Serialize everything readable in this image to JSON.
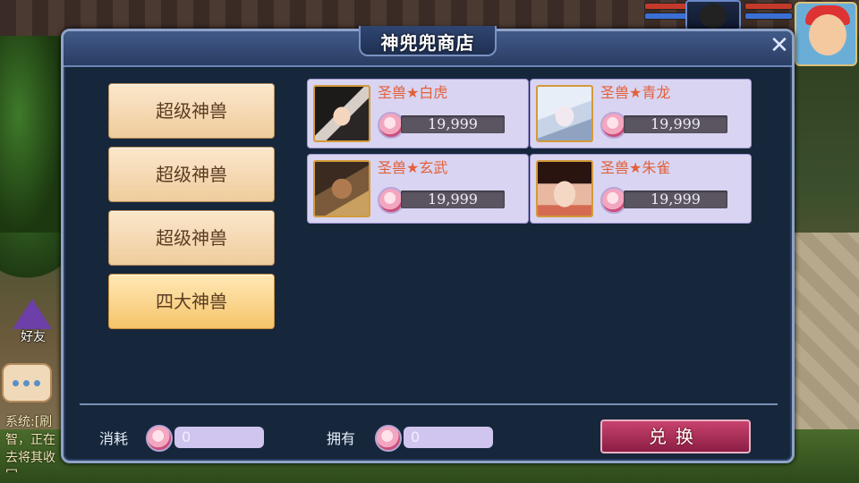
{
  "shop": {
    "title": "神兜兜商店",
    "close_symbol": "✕"
  },
  "categories": [
    {
      "label": "超级神兽",
      "active": false
    },
    {
      "label": "超级神兽",
      "active": false
    },
    {
      "label": "超级神兽",
      "active": false
    },
    {
      "label": "四大神兽",
      "active": true
    }
  ],
  "items": [
    {
      "name": "圣兽★白虎",
      "price": "19,999",
      "portrait_icon": "white-tiger-portrait"
    },
    {
      "name": "圣兽★青龙",
      "price": "19,999",
      "portrait_icon": "azure-dragon-portrait"
    },
    {
      "name": "圣兽★玄武",
      "price": "19,999",
      "portrait_icon": "black-tortoise-portrait"
    },
    {
      "name": "圣兽★朱雀",
      "price": "19,999",
      "portrait_icon": "vermilion-bird-portrait"
    }
  ],
  "footer": {
    "cost_label": "消耗",
    "cost_value": "0",
    "own_label": "拥有",
    "own_value": "0",
    "exchange_label": "兑换"
  },
  "hud": {
    "friend_label": "好友",
    "chat_lines": [
      "系统:[刷",
      "智，正在",
      "去将其收回"
    ]
  },
  "colors": {
    "accent": "#e2603a",
    "card_bg": "#d9d4f1",
    "exchange_btn": "#a82a55",
    "dialog_bg": "#16273b"
  }
}
